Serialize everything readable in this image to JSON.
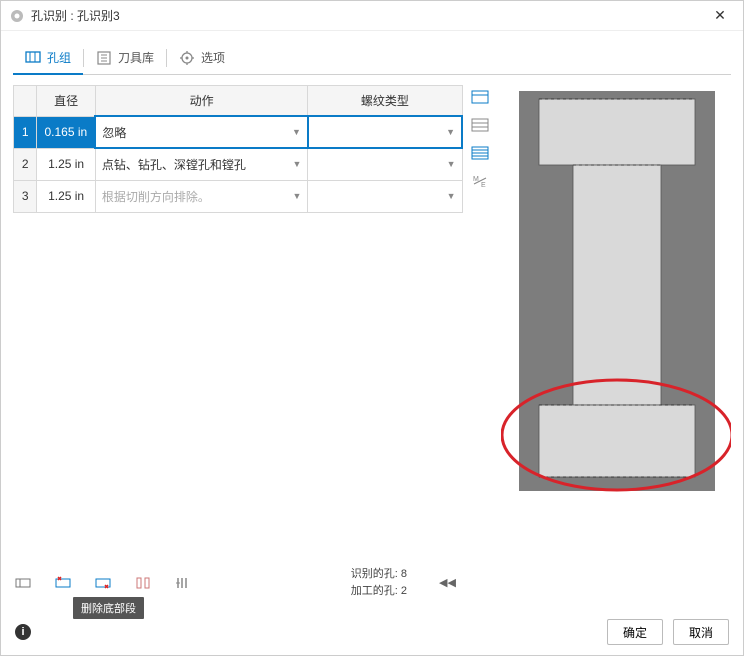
{
  "window": {
    "title": "孔识别 : 孔识别3"
  },
  "tabs": [
    {
      "label": "孔组",
      "active": true
    },
    {
      "label": "刀具库",
      "active": false
    },
    {
      "label": "选项",
      "active": false
    }
  ],
  "table": {
    "headers": {
      "diameter": "直径",
      "action": "动作",
      "thread": "螺纹类型"
    },
    "rows": [
      {
        "idx": "1",
        "diameter": "0.165 in",
        "action": "忽略",
        "thread": "",
        "selected": true,
        "muted": false
      },
      {
        "idx": "2",
        "diameter": "1.25 in",
        "action": "点钻、钻孔、深镗孔和镗孔",
        "thread": "",
        "selected": false,
        "muted": false
      },
      {
        "idx": "3",
        "diameter": "1.25 in",
        "action": "根据切削方向排除。",
        "thread": "",
        "selected": false,
        "muted": true
      }
    ]
  },
  "side_icons": [
    "row-view-1",
    "row-view-2",
    "row-view-3",
    "unit-toggle"
  ],
  "toolbar": {
    "buttons": [
      "tool-delete-group",
      "tool-flag-group",
      "tool-delete-bottom",
      "tool-segment",
      "tool-columns"
    ],
    "tooltip": "删除底部段"
  },
  "stats": {
    "recognized_label": "识别的孔:",
    "recognized_value": "8",
    "machined_label": "加工的孔:",
    "machined_value": "2"
  },
  "footer": {
    "ok": "确定",
    "cancel": "取消"
  }
}
